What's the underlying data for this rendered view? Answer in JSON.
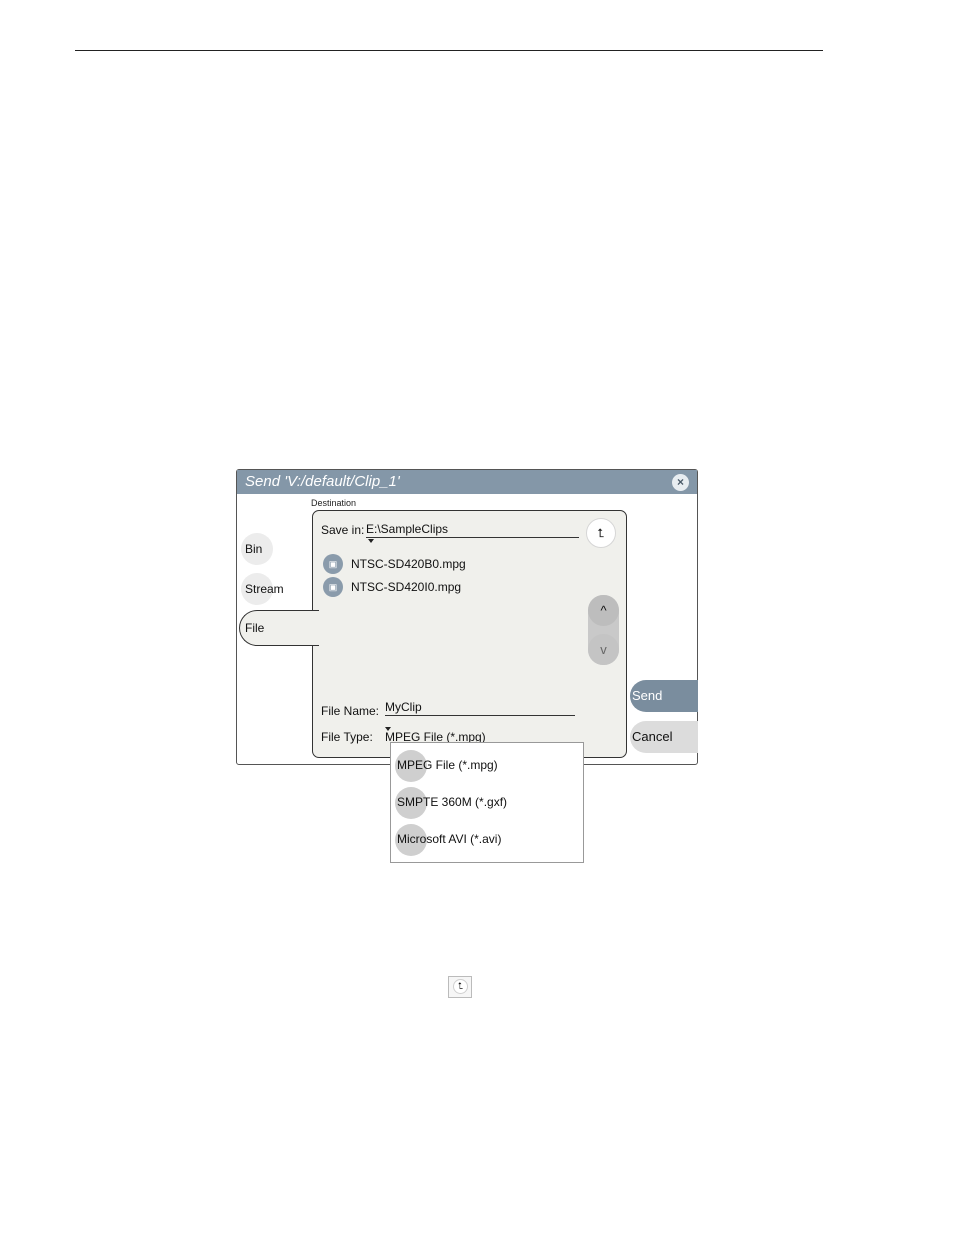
{
  "dialog": {
    "title": "Send 'V:/default/Clip_1'",
    "close_icon": "×",
    "destination_label": "Destination"
  },
  "tabs": [
    {
      "label": "Bin"
    },
    {
      "label": "Stream"
    },
    {
      "label": "File"
    }
  ],
  "panel": {
    "save_in_label": "Save in:",
    "save_in_path": "E:\\SampleClips",
    "up_folder_icon": "⮤",
    "files": [
      {
        "name": "NTSC-SD420B0.mpg",
        "icon": "mpg-file-icon"
      },
      {
        "name": "NTSC-SD420I0.mpg",
        "icon": "mpg-file-icon"
      }
    ],
    "scroll_up_icon": "^",
    "scroll_down_icon": "v",
    "file_name_label": "File Name:",
    "file_name_value": "MyClip",
    "file_type_label": "File Type:",
    "file_type_value": "MPEG File (*.mpg)"
  },
  "actions": {
    "send": "Send",
    "cancel": "Cancel"
  },
  "file_type_options": [
    "MPEG File (*.mpg)",
    "SMPTE 360M (*.gxf)",
    "Microsoft AVI (*.avi)"
  ],
  "inline_icon": "⮤"
}
